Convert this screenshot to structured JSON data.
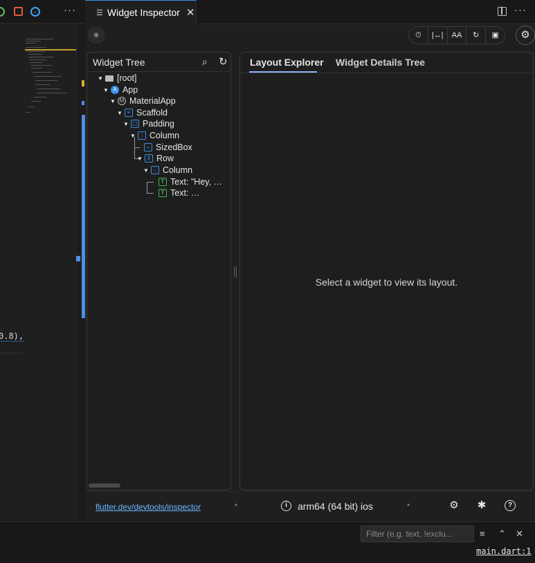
{
  "tab": {
    "icon": "menu-lines-icon",
    "title": "Widget Inspector",
    "close_glyph": "✕"
  },
  "tabbar_actions": {
    "split_icon": "split-editor-icon",
    "more_glyph": "···"
  },
  "left_toolbar": {
    "more_glyph": "···"
  },
  "editor": {
    "code_visible": "0.8),"
  },
  "toolbar": {
    "select_icon": "select-widget-icon",
    "tools": [
      {
        "icon": "timer-icon",
        "glyph": "⏱"
      },
      {
        "icon": "baseline-icon",
        "glyph": "|↔|"
      },
      {
        "icon": "text-size-icon",
        "glyph": "AA"
      },
      {
        "icon": "repaint-icon",
        "glyph": "↻"
      },
      {
        "icon": "image-icon",
        "glyph": "▣"
      }
    ],
    "settings_glyph": "⚙"
  },
  "widget_tree": {
    "title": "Widget Tree",
    "search_glyph": "⌕",
    "refresh_glyph": "↻",
    "nodes": [
      {
        "label": "[root]",
        "icon": "folder-icon"
      },
      {
        "label": "App",
        "icon": "app-icon",
        "icon_text": "A"
      },
      {
        "label": "MaterialApp",
        "icon": "material-icon",
        "icon_text": "M"
      },
      {
        "label": "Scaffold",
        "icon": "scaffold-icon",
        "icon_text": "≡"
      },
      {
        "label": "Padding",
        "icon": "padding-icon",
        "icon_text": "▢"
      },
      {
        "label": "Column",
        "icon": "column-icon",
        "icon_text": "⋮"
      },
      {
        "label": "SizedBox",
        "icon": "sizedbox-icon",
        "icon_text": "↔"
      },
      {
        "label": "Row",
        "icon": "row-icon",
        "icon_text": "⫼"
      },
      {
        "label": "Column",
        "icon": "column-icon",
        "icon_text": "⋮"
      },
      {
        "label": "Text: \"Hey, …",
        "icon": "text-icon",
        "icon_text": "T"
      },
      {
        "label": "Text: …",
        "icon": "text-icon",
        "icon_text": "T"
      }
    ]
  },
  "layout": {
    "tabs": [
      "Layout Explorer",
      "Widget Details Tree"
    ],
    "active_tab": 0,
    "empty_message": "Select a widget to view its layout."
  },
  "status": {
    "link": "flutter.dev/devtools/inspector",
    "separator": "•",
    "device": "arm64 (64 bit) ios",
    "info_glyph": "i",
    "gear_glyph": "⚙",
    "bug_glyph": "✱",
    "help_glyph": "?"
  },
  "findbar": {
    "filter_placeholder": "Filter (e.g. text, !exclu...",
    "filter_value": "",
    "filter_icon_glyph": "≡",
    "up_glyph": "⌃",
    "close_glyph": "✕",
    "file_link": "main.dart:1"
  },
  "colors": {
    "accent": "#3b8eea",
    "active_tab_underline": "#8ab4f8",
    "link": "#6cb6ff",
    "widget_icon_blue": "#3a8ee6",
    "text_icon_green": "#3fb950"
  }
}
